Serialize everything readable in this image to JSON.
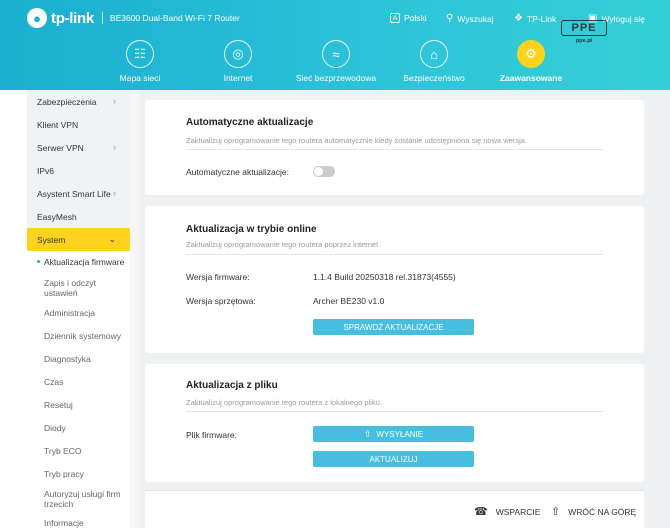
{
  "header": {
    "logo_text": "tp-link",
    "model": "BE3600 Dual-Band Wi-Fi 7 Router",
    "language": "Polski",
    "search": "Wyszukaj",
    "tplink_id": "TP-Link",
    "logout": "Wyloguj się",
    "lang_icon_glyph": "A"
  },
  "nav": [
    {
      "label": "Mapa sieci",
      "icon": "network-map-icon"
    },
    {
      "label": "Internet",
      "icon": "globe-icon"
    },
    {
      "label": "Sieć bezprzewodowa",
      "icon": "wifi-icon"
    },
    {
      "label": "Bezpieczeństwo",
      "icon": "home-shield-icon"
    },
    {
      "label": "Zaawansowane",
      "icon": "gear-icon",
      "active": true
    }
  ],
  "watermark": {
    "mark": "PPE",
    "sub": "ppe.pl"
  },
  "sidebar": {
    "items": [
      {
        "label": "Zabezpieczenia",
        "has_chevron": true
      },
      {
        "label": "Klient VPN",
        "has_chevron": false
      },
      {
        "label": "Serwer VPN",
        "has_chevron": true
      },
      {
        "label": "IPv6",
        "has_chevron": false
      },
      {
        "label": "Asystent Smart Life",
        "has_chevron": true
      },
      {
        "label": "EasyMesh",
        "has_chevron": false
      },
      {
        "label": "System",
        "has_chevron": true,
        "active": true
      }
    ],
    "subitems": [
      {
        "label": "Aktualizacja firmware",
        "active": true
      },
      {
        "label": "Zapis i odczyt ustawień"
      },
      {
        "label": "Administracja"
      },
      {
        "label": "Dziennik systemowy"
      },
      {
        "label": "Diagnostyka"
      },
      {
        "label": "Czas"
      },
      {
        "label": "Resetuj"
      },
      {
        "label": "Diody"
      },
      {
        "label": "Tryb ECO"
      },
      {
        "label": "Tryb pracy"
      },
      {
        "label": "Autoryzuj usługi firm trzecich"
      },
      {
        "label": "Informacje"
      }
    ]
  },
  "auto_update": {
    "title": "Automatyczne aktualizacje",
    "desc": "Zaktualizuj oprogramowanie tego routera automatycznie kiedy zostanie udostępniona się nowa wersja.",
    "toggle_label": "Automatyczne aktualizacje:",
    "toggle_on": false
  },
  "online_update": {
    "title": "Aktualizacja w trybie online",
    "desc": "Zaktualizuj oprogramowanie tego routera poprzez internet.",
    "firmware_label": "Wersja firmware:",
    "firmware_value": "1.1.4 Build 20250318 rel.31873(4555)",
    "hardware_label": "Wersja sprzętowa:",
    "hardware_value": "Archer BE230 v1.0",
    "check_button": "SPRAWDŹ AKTUALIZACJE"
  },
  "file_update": {
    "title": "Aktualizacja z pliku",
    "desc": "Zaktualizuj oprogramowanie tego routera z lokalnego pliku.",
    "file_label": "Plik firmware:",
    "upload_button": "WYSYŁANIE",
    "update_button": "AKTUALIZUJ"
  },
  "footer": {
    "support": "WSPARCIE",
    "back_to_top": "WRÓĆ NA GÓRĘ"
  },
  "colors": {
    "header_start": "#1aaed0",
    "header_end": "#35cfd6",
    "accent_yellow": "#ffd21e",
    "button_blue": "#47bde0"
  }
}
